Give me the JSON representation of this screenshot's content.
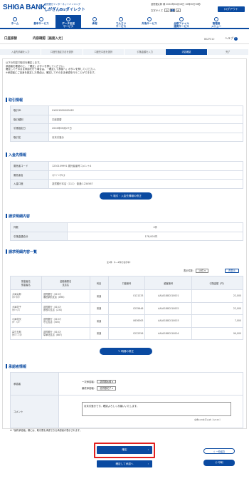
{
  "header": {
    "brand": "SHIGA BANK",
    "tagline": "滋賀銀行インターネットバンキング",
    "product": "しがぎんBizダイレクト",
    "user_line": "滋賀銀太郎 様  20XX年04月16日 10時30分00秒",
    "font_size_label": "文字サイズ",
    "font_sizes": [
      "小",
      "中",
      "大"
    ],
    "logout": "ログアウト"
  },
  "nav": [
    {
      "label": "ホーム"
    },
    {
      "label": "基本サービス"
    },
    {
      "label": "データ伝送\nサービス"
    },
    {
      "label": "承認"
    },
    {
      "label": "でんさい\nサービス"
    },
    {
      "label": "外為サービス"
    },
    {
      "label": "全銀ファイル\n連携サービス"
    },
    {
      "label": "管理者\nメニュー"
    }
  ],
  "page": {
    "crumb": "口座振替",
    "title": "内容確認［画面入力］",
    "code": "BKZF010",
    "help": "ヘルプ"
  },
  "steps": [
    "入金先情報を入力",
    "口座先指定方法を選択",
    "口座先口座を選択",
    "引落金額を入力",
    "内容確認",
    "完了"
  ],
  "intro": [
    "以下の内容で取引を確定します。",
    "承認者を確認の上、「確定」ボタンを押してください。",
    "確定してそのまま承認を行う場合は、「確定して承認へ」ボタンを押してください。",
    "※承認者にご自身を設定した場合は、確定してそのまま承認を行うことができます。"
  ],
  "torihiki": {
    "title": "取引情報",
    "rows": [
      {
        "k": "取引ID",
        "v": "XXXX1800000062"
      },
      {
        "k": "取引種別",
        "v": "口座振替"
      },
      {
        "k": "引落指定日",
        "v": "20XX年06月27日"
      },
      {
        "k": "取引名",
        "v": "月末引落分"
      }
    ]
  },
  "nyukin": {
    "title": "入金先情報",
    "rows": [
      {
        "k": "委託者コード",
        "v": "1230109991 委託者番号コメント4"
      },
      {
        "k": "委託者名",
        "v": "ｼｶﾞｷﾞﾝｺｳﾘ(ｶ"
      },
      {
        "k": "入金口座",
        "v": "滋賀銀行本店（111） 普通 1234567"
      }
    ],
    "button": "取引・入金先情報の修正"
  },
  "seikyu": {
    "title": "請求明細内容",
    "rows": [
      {
        "k": "件数",
        "v": "4件"
      },
      {
        "k": "引落金額合計",
        "v": "178,000円"
      }
    ]
  },
  "ichiran": {
    "title": "請求明細内容一覧",
    "count_text": "全4件（1~4件を表示中）",
    "per_page_label": "表示件数：",
    "per_page": "10件",
    "redisplay": "再表示",
    "headers": [
      "預金者名\n預金者名",
      "金融機関名\n支店名",
      "科目",
      "口座番号",
      "顧客番号",
      "引落金額（円）"
    ],
    "rows": [
      {
        "name": "大津太郎\nｵｵﾂ ﾀﾛｳ",
        "bank": "滋賀銀行（0157）\n瀬田駅前支店（896）",
        "kamoku": "普通",
        "account": "0121233",
        "customer": "AAA0188C010001",
        "amount": "22,000"
      },
      {
        "name": "大津花子\nｵｵﾂ ﾊﾅｺ",
        "bank": "滋賀銀行（0157）\n彦根の支店（234）",
        "kamoku": "普通",
        "account": "0235646",
        "customer": "AAA0188C010002",
        "amount": "22,000"
      },
      {
        "name": "小津花次\nｵﾂﾞ ﾊﾅｼﾞ",
        "bank": "滋賀銀行（0157）\n守山支店（505）",
        "kamoku": "普通",
        "account": "0636363",
        "customer": "AAA0188C010003",
        "amount": "7,000"
      },
      {
        "name": "高島五郎\nﾀｶｼﾏ ｺﾞﾛｳ",
        "bank": "滋賀銀行（0157）\n草津北支店（887）",
        "kamoku": "普通",
        "account": "0222356",
        "customer": "AAA0188C010004",
        "amount": "99,000"
      }
    ],
    "button": "明細の修正"
  },
  "shoninsha": {
    "title": "承認者情報",
    "approver_label": "承認者",
    "first_label": "一次承認者：",
    "first_value": "滋賀銀太郎",
    "final_label": "最終承認者：",
    "final_value": "滋賀銀花子",
    "comment_label": "コメント",
    "comment": "月末引落分です。確認よろしくお願いいたします。",
    "counter": "全角120文字以内［4/120］",
    "note": "※「最終承認者」欄には、取引限を承認できる承認者が表示されます。"
  },
  "actions": {
    "confirm": "確定",
    "confirm_and_approve": "確定して承認へ",
    "save": "一時保存",
    "print": "印刷"
  },
  "colors": {
    "brand": "#0a4aa1",
    "highlight": "#e02020",
    "label_bg": "#eef2f7"
  }
}
